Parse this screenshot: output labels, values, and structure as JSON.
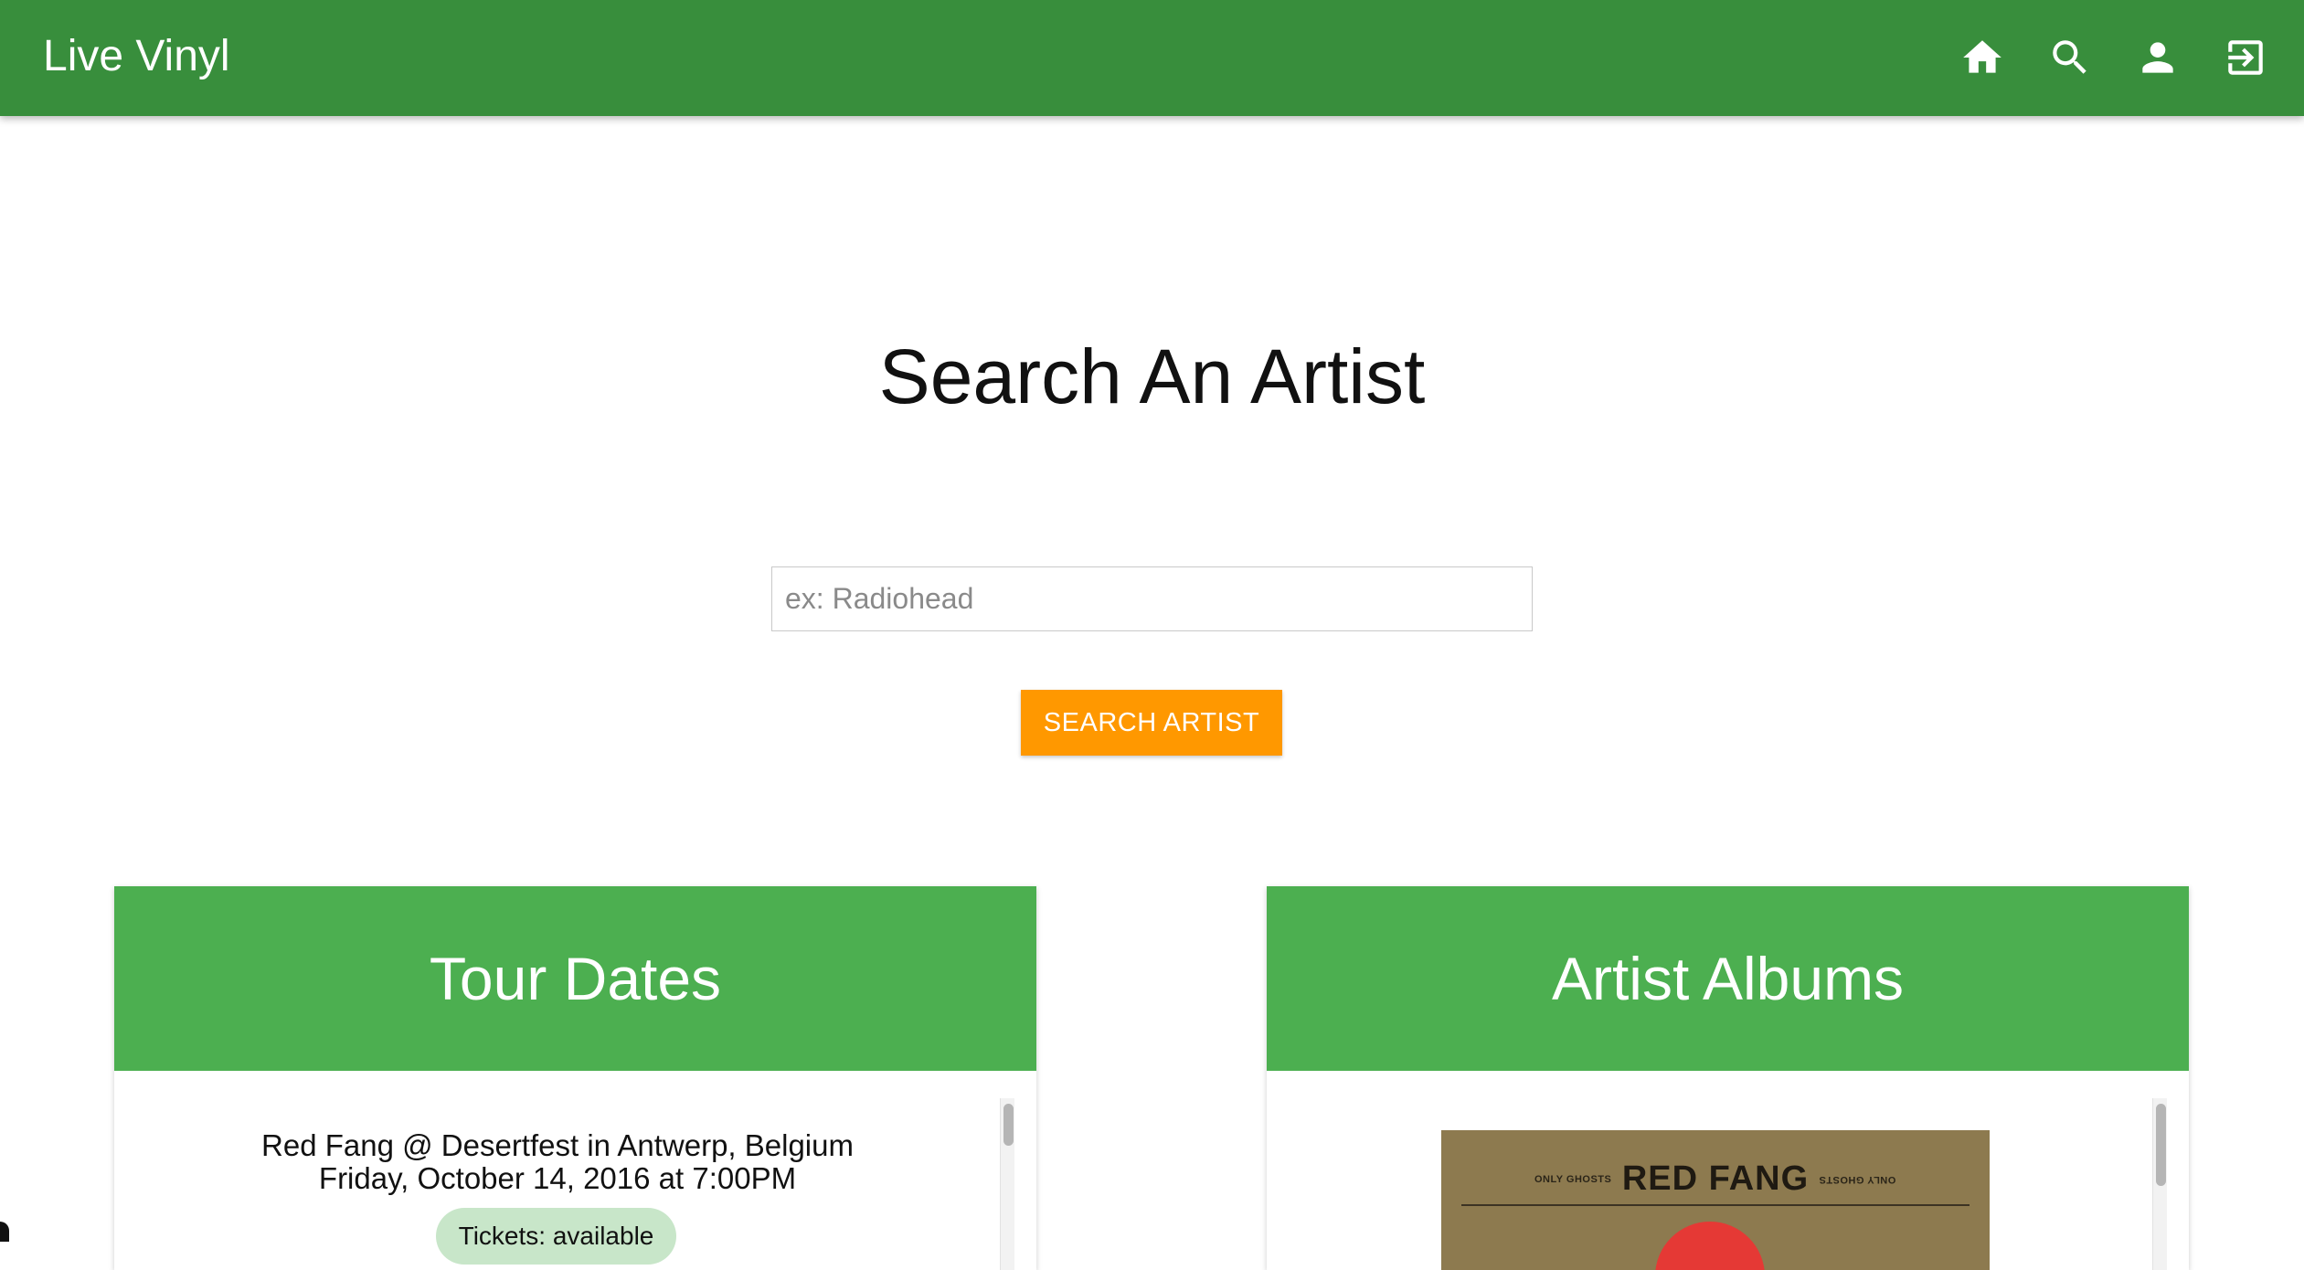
{
  "app": {
    "title": "Live Vinyl"
  },
  "nav": {
    "icons": [
      "home-icon",
      "search-icon",
      "person-icon",
      "exit-icon"
    ]
  },
  "search": {
    "heading": "Search An Artist",
    "placeholder": "ex: Radiohead",
    "value": "",
    "button_label": "Search Artist"
  },
  "tour_dates": {
    "title": "Tour Dates",
    "events": [
      {
        "title": "Red Fang @ Desertfest in Antwerp, Belgium",
        "datetime": "Friday, October 14, 2016 at 7:00PM",
        "tickets": "Tickets: available"
      }
    ]
  },
  "albums": {
    "title": "Artist Albums",
    "items": [
      {
        "band": "RED FANG",
        "tagline": "ONLY GHOSTS"
      }
    ]
  },
  "colors": {
    "navbar": "#388e3c",
    "card_header": "#4caf50",
    "accent_button": "#ff9800",
    "ticket_badge": "#c8e6c9"
  }
}
